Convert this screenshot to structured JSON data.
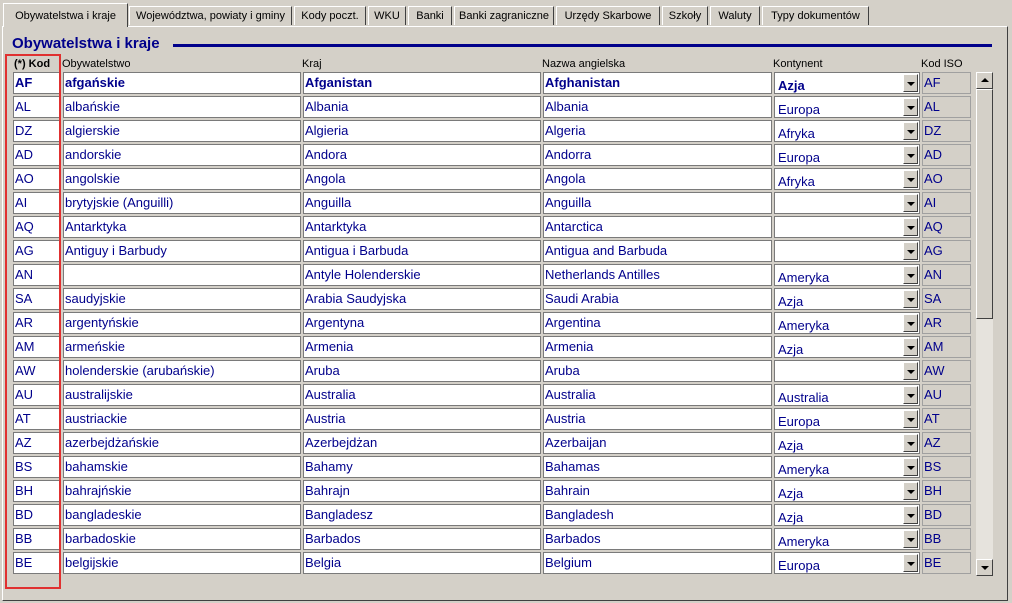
{
  "tabs": [
    {
      "label": "Obywatelstwa i kraje",
      "active": true
    },
    {
      "label": "Województwa, powiaty i gminy",
      "active": false
    },
    {
      "label": "Kody poczt.",
      "active": false
    },
    {
      "label": "WKU",
      "active": false
    },
    {
      "label": "Banki",
      "active": false
    },
    {
      "label": "Banki zagraniczne",
      "active": false
    },
    {
      "label": "Urzędy Skarbowe",
      "active": false
    },
    {
      "label": "Szkoły",
      "active": false
    },
    {
      "label": "Waluty",
      "active": false
    },
    {
      "label": "Typy dokumentów",
      "active": false
    }
  ],
  "section_title": "Obywatelstwa i kraje",
  "columns": {
    "kod": "(*) Kod",
    "obywatelstwo": "Obywatelstwo",
    "kraj": "Kraj",
    "nazwa_angielska": "Nazwa angielska",
    "kontynent": "Kontynent",
    "kod_iso": "Kod ISO"
  },
  "rows": [
    {
      "kod": "AF",
      "obywatelstwo": "afgańskie",
      "kraj": "Afganistan",
      "nazwa": "Afghanistan",
      "kontynent": "Azja",
      "iso": "AF"
    },
    {
      "kod": "AL",
      "obywatelstwo": "albańskie",
      "kraj": "Albania",
      "nazwa": "Albania",
      "kontynent": "Europa",
      "iso": "AL"
    },
    {
      "kod": "DZ",
      "obywatelstwo": "algierskie",
      "kraj": "Algieria",
      "nazwa": "Algeria",
      "kontynent": "Afryka",
      "iso": "DZ"
    },
    {
      "kod": "AD",
      "obywatelstwo": "andorskie",
      "kraj": "Andora",
      "nazwa": "Andorra",
      "kontynent": "Europa",
      "iso": "AD"
    },
    {
      "kod": "AO",
      "obywatelstwo": "angolskie",
      "kraj": "Angola",
      "nazwa": "Angola",
      "kontynent": "Afryka",
      "iso": "AO"
    },
    {
      "kod": "AI",
      "obywatelstwo": "brytyjskie (Anguilli)",
      "kraj": "Anguilla",
      "nazwa": "Anguilla",
      "kontynent": "",
      "iso": "AI"
    },
    {
      "kod": "AQ",
      "obywatelstwo": "Antarktyka",
      "kraj": "Antarktyka",
      "nazwa": "Antarctica",
      "kontynent": "",
      "iso": "AQ"
    },
    {
      "kod": "AG",
      "obywatelstwo": "Antiguy i Barbudy",
      "kraj": "Antigua i Barbuda",
      "nazwa": "Antigua and Barbuda",
      "kontynent": "",
      "iso": "AG"
    },
    {
      "kod": "AN",
      "obywatelstwo": "",
      "kraj": "Antyle Holenderskie",
      "nazwa": "Netherlands Antilles",
      "kontynent": "Ameryka",
      "iso": "AN"
    },
    {
      "kod": "SA",
      "obywatelstwo": "saudyjskie",
      "kraj": "Arabia Saudyjska",
      "nazwa": "Saudi Arabia",
      "kontynent": "Azja",
      "iso": "SA"
    },
    {
      "kod": "AR",
      "obywatelstwo": "argentyńskie",
      "kraj": "Argentyna",
      "nazwa": "Argentina",
      "kontynent": "Ameryka",
      "iso": "AR"
    },
    {
      "kod": "AM",
      "obywatelstwo": "armeńskie",
      "kraj": "Armenia",
      "nazwa": "Armenia",
      "kontynent": "Azja",
      "iso": "AM"
    },
    {
      "kod": "AW",
      "obywatelstwo": "holenderskie (arubańskie)",
      "kraj": "Aruba",
      "nazwa": "Aruba",
      "kontynent": "",
      "iso": "AW"
    },
    {
      "kod": "AU",
      "obywatelstwo": "australijskie",
      "kraj": "Australia",
      "nazwa": "Australia",
      "kontynent": "Australia",
      "iso": "AU"
    },
    {
      "kod": "AT",
      "obywatelstwo": "austriackie",
      "kraj": "Austria",
      "nazwa": "Austria",
      "kontynent": "Europa",
      "iso": "AT"
    },
    {
      "kod": "AZ",
      "obywatelstwo": "azerbejdżańskie",
      "kraj": "Azerbejdżan",
      "nazwa": "Azerbaijan",
      "kontynent": "Azja",
      "iso": "AZ"
    },
    {
      "kod": "BS",
      "obywatelstwo": "bahamskie",
      "kraj": "Bahamy",
      "nazwa": "Bahamas",
      "kontynent": "Ameryka",
      "iso": "BS"
    },
    {
      "kod": "BH",
      "obywatelstwo": "bahrajńskie",
      "kraj": "Bahrajn",
      "nazwa": "Bahrain",
      "kontynent": "Azja",
      "iso": "BH"
    },
    {
      "kod": "BD",
      "obywatelstwo": "bangladeskie",
      "kraj": "Bangladesz",
      "nazwa": "Bangladesh",
      "kontynent": "Azja",
      "iso": "BD"
    },
    {
      "kod": "BB",
      "obywatelstwo": "barbadoskie",
      "kraj": "Barbados",
      "nazwa": "Barbados",
      "kontynent": "Ameryka",
      "iso": "BB"
    },
    {
      "kod": "BE",
      "obywatelstwo": "belgijskie",
      "kraj": "Belgia",
      "nazwa": "Belgium",
      "kontynent": "Europa",
      "iso": "BE"
    }
  ],
  "colors": {
    "text": "#00008b",
    "highlight": "#e03030"
  }
}
